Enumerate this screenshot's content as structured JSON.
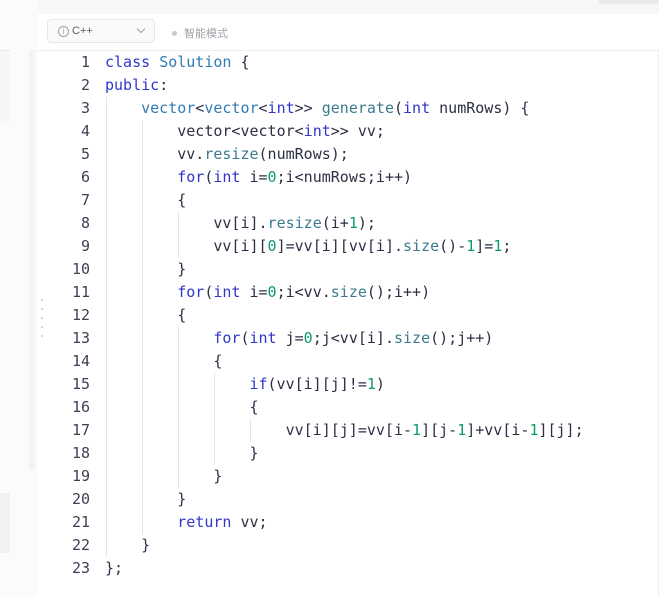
{
  "toolbar": {
    "language": "C++",
    "mode_label": "智能模式"
  },
  "editor": {
    "lines": [
      {
        "n": "1",
        "indent": 0,
        "tokens": [
          {
            "t": "class",
            "c": "kw"
          },
          {
            "t": " "
          },
          {
            "t": "Solution",
            "c": "cls"
          },
          {
            "t": " {"
          }
        ]
      },
      {
        "n": "2",
        "indent": 0,
        "tokens": [
          {
            "t": "public",
            "c": "kw"
          },
          {
            "t": ":"
          }
        ]
      },
      {
        "n": "3",
        "indent": 1,
        "tokens": [
          {
            "t": "vector",
            "c": "cls"
          },
          {
            "t": "<"
          },
          {
            "t": "vector",
            "c": "cls"
          },
          {
            "t": "<"
          },
          {
            "t": "int",
            "c": "kw"
          },
          {
            "t": ">> "
          },
          {
            "t": "generate",
            "c": "fn"
          },
          {
            "t": "("
          },
          {
            "t": "int",
            "c": "kw"
          },
          {
            "t": " numRows) {"
          }
        ]
      },
      {
        "n": "4",
        "indent": 2,
        "tokens": [
          {
            "t": "vector<vector<"
          },
          {
            "t": "int",
            "c": "kw"
          },
          {
            "t": ">> vv;"
          }
        ]
      },
      {
        "n": "5",
        "indent": 2,
        "tokens": [
          {
            "t": "vv."
          },
          {
            "t": "resize",
            "c": "fn"
          },
          {
            "t": "(numRows);"
          }
        ]
      },
      {
        "n": "6",
        "indent": 2,
        "tokens": [
          {
            "t": "for",
            "c": "kw"
          },
          {
            "t": "("
          },
          {
            "t": "int",
            "c": "kw"
          },
          {
            "t": " i="
          },
          {
            "t": "0",
            "c": "num"
          },
          {
            "t": ";i<numRows;i++)"
          }
        ]
      },
      {
        "n": "7",
        "indent": 2,
        "tokens": [
          {
            "t": "{"
          }
        ]
      },
      {
        "n": "8",
        "indent": 3,
        "tokens": [
          {
            "t": "vv[i]."
          },
          {
            "t": "resize",
            "c": "fn"
          },
          {
            "t": "(i+"
          },
          {
            "t": "1",
            "c": "num"
          },
          {
            "t": ");"
          }
        ]
      },
      {
        "n": "9",
        "indent": 3,
        "tokens": [
          {
            "t": "vv[i]["
          },
          {
            "t": "0",
            "c": "num"
          },
          {
            "t": "]=vv[i][vv[i]."
          },
          {
            "t": "size",
            "c": "fn"
          },
          {
            "t": "()-"
          },
          {
            "t": "1",
            "c": "num"
          },
          {
            "t": "]="
          },
          {
            "t": "1",
            "c": "num"
          },
          {
            "t": ";"
          }
        ]
      },
      {
        "n": "10",
        "indent": 2,
        "tokens": [
          {
            "t": "}"
          }
        ]
      },
      {
        "n": "11",
        "indent": 2,
        "tokens": [
          {
            "t": "for",
            "c": "kw"
          },
          {
            "t": "("
          },
          {
            "t": "int",
            "c": "kw"
          },
          {
            "t": " i="
          },
          {
            "t": "0",
            "c": "num"
          },
          {
            "t": ";i<vv."
          },
          {
            "t": "size",
            "c": "fn"
          },
          {
            "t": "();i++)"
          }
        ]
      },
      {
        "n": "12",
        "indent": 2,
        "tokens": [
          {
            "t": "{"
          }
        ]
      },
      {
        "n": "13",
        "indent": 3,
        "tokens": [
          {
            "t": "for",
            "c": "kw"
          },
          {
            "t": "("
          },
          {
            "t": "int",
            "c": "kw"
          },
          {
            "t": " j="
          },
          {
            "t": "0",
            "c": "num"
          },
          {
            "t": ";j<vv[i]."
          },
          {
            "t": "size",
            "c": "fn"
          },
          {
            "t": "();j++)"
          }
        ]
      },
      {
        "n": "14",
        "indent": 3,
        "tokens": [
          {
            "t": "{"
          }
        ]
      },
      {
        "n": "15",
        "indent": 4,
        "tokens": [
          {
            "t": "if",
            "c": "kw"
          },
          {
            "t": "(vv[i][j]!="
          },
          {
            "t": "1",
            "c": "num"
          },
          {
            "t": ")"
          }
        ]
      },
      {
        "n": "16",
        "indent": 4,
        "tokens": [
          {
            "t": "{"
          }
        ]
      },
      {
        "n": "17",
        "indent": 5,
        "tokens": [
          {
            "t": "vv[i][j]=vv[i-"
          },
          {
            "t": "1",
            "c": "num"
          },
          {
            "t": "][j-"
          },
          {
            "t": "1",
            "c": "num"
          },
          {
            "t": "]+vv[i-"
          },
          {
            "t": "1",
            "c": "num"
          },
          {
            "t": "][j];"
          }
        ]
      },
      {
        "n": "18",
        "indent": 4,
        "tokens": [
          {
            "t": "}"
          }
        ]
      },
      {
        "n": "19",
        "indent": 3,
        "tokens": [
          {
            "t": "}"
          }
        ]
      },
      {
        "n": "20",
        "indent": 2,
        "tokens": [
          {
            "t": "}"
          }
        ]
      },
      {
        "n": "21",
        "indent": 2,
        "tokens": [
          {
            "t": "return",
            "c": "kw"
          },
          {
            "t": " vv;"
          }
        ]
      },
      {
        "n": "22",
        "indent": 1,
        "tokens": [
          {
            "t": "}"
          }
        ]
      },
      {
        "n": "23",
        "indent": 0,
        "tokens": [
          {
            "t": "};"
          }
        ]
      }
    ],
    "colors": {
      "keyword": "#2f36c9",
      "type": "#2f7cb5",
      "function": "#3c7a90",
      "number": "#0b9b6b",
      "text": "#2c2f45"
    }
  }
}
